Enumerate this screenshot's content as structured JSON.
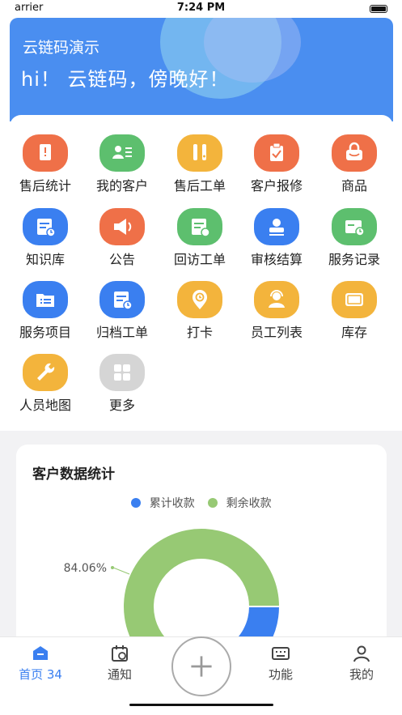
{
  "status_bar": {
    "carrier": "arrier",
    "time": "7:24 PM"
  },
  "header": {
    "company": "云链码演示",
    "greeting": "hi！ 云链码，傍晚好！",
    "color": "#4a8ef0"
  },
  "grid": [
    {
      "label": "售后统计",
      "icon": "stats-icon",
      "color": "#ef7048"
    },
    {
      "label": "我的客户",
      "icon": "customers-icon",
      "color": "#5dbf6e"
    },
    {
      "label": "售后工单",
      "icon": "tools-icon",
      "color": "#f3b43c"
    },
    {
      "label": "客户报修",
      "icon": "clipboard-icon",
      "color": "#ef7048"
    },
    {
      "label": "商品",
      "icon": "bag-icon",
      "color": "#ef7048"
    },
    {
      "label": "知识库",
      "icon": "knowledge-icon",
      "color": "#3a7ff0"
    },
    {
      "label": "公告",
      "icon": "speaker-icon",
      "color": "#ef7048"
    },
    {
      "label": "回访工单",
      "icon": "revisit-icon",
      "color": "#5dbf6e"
    },
    {
      "label": "审核结算",
      "icon": "audit-icon",
      "color": "#3a7ff0"
    },
    {
      "label": "服务记录",
      "icon": "service-record-icon",
      "color": "#5dbf6e"
    },
    {
      "label": "服务项目",
      "icon": "folder-icon",
      "color": "#3a7ff0"
    },
    {
      "label": "归档工单",
      "icon": "archive-icon",
      "color": "#3a7ff0"
    },
    {
      "label": "打卡",
      "icon": "checkin-icon",
      "color": "#f3b43c"
    },
    {
      "label": "员工列表",
      "icon": "staff-icon",
      "color": "#f3b43c"
    },
    {
      "label": "库存",
      "icon": "inventory-icon",
      "color": "#f3b43c"
    },
    {
      "label": "人员地图",
      "icon": "wrench-icon",
      "color": "#f3b43c"
    },
    {
      "label": "更多",
      "icon": "more-grid-icon",
      "color": "#d5d5d5"
    }
  ],
  "chart_data": {
    "type": "pie",
    "title": "客户数据统计",
    "series": [
      {
        "name": "累计收款",
        "color": "#3a7ff0",
        "value": 15.94
      },
      {
        "name": "剩余收款",
        "color": "#97c974",
        "value": 84.06
      }
    ],
    "data_labels": [
      "84.06%"
    ],
    "legend_position": "top"
  },
  "tabbar": [
    {
      "label": "首页 34",
      "icon": "home-icon",
      "active": true
    },
    {
      "label": "通知",
      "icon": "calendar-icon",
      "active": false
    },
    {
      "label": "",
      "icon": "plus-icon",
      "active": false
    },
    {
      "label": "功能",
      "icon": "keyboard-icon",
      "active": false
    },
    {
      "label": "我的",
      "icon": "user-icon",
      "active": false
    }
  ]
}
